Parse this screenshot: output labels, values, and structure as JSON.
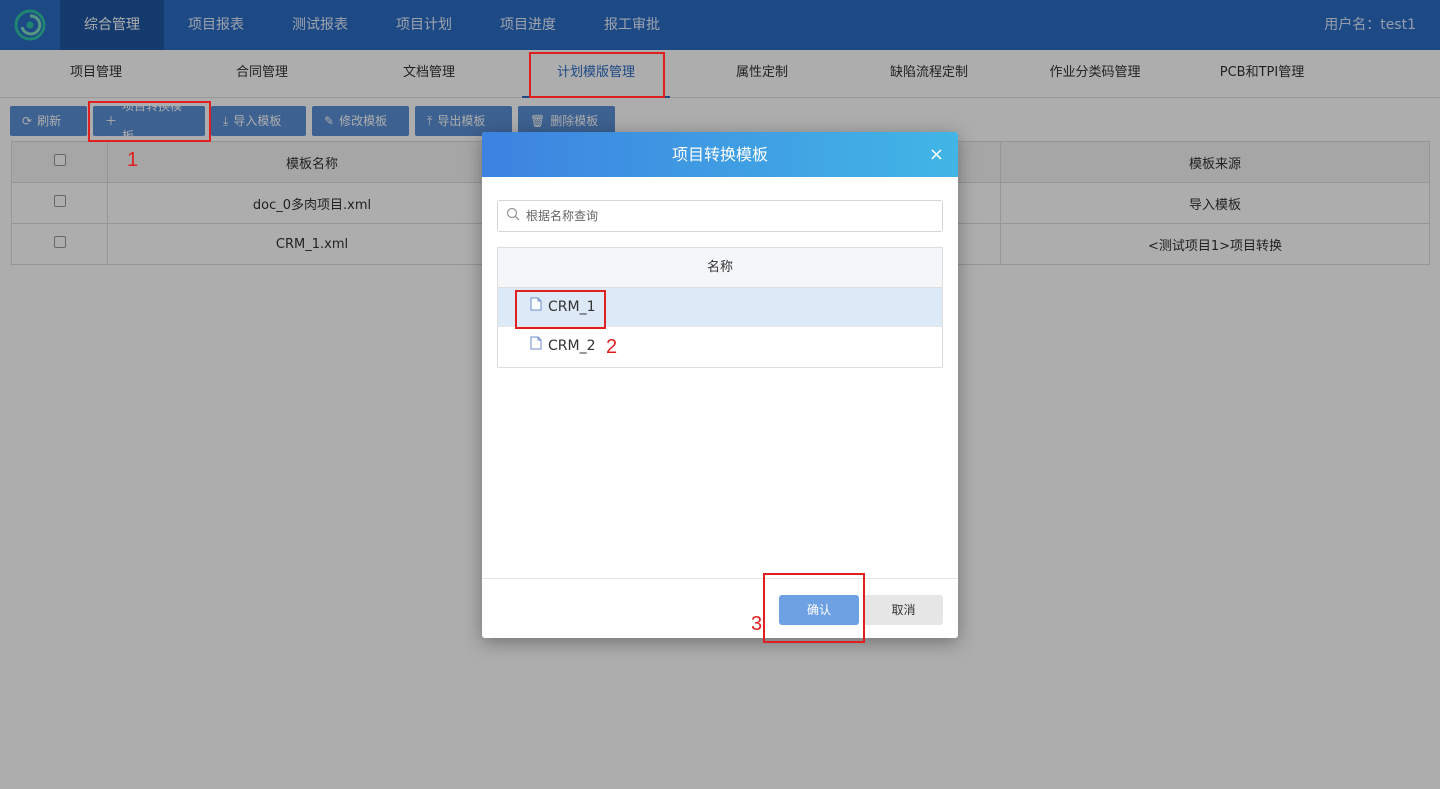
{
  "topnav": {
    "items": [
      "综合管理",
      "项目报表",
      "测试报表",
      "项目计划",
      "项目进度",
      "报工审批"
    ],
    "username": "用户名：test1"
  },
  "subnav": {
    "items": [
      "项目管理",
      "合同管理",
      "文档管理",
      "计划模版管理",
      "属性定制",
      "缺陷流程定制",
      "作业分类码管理",
      "PCB和TPI管理"
    ]
  },
  "toolbar": {
    "refresh": "刷新",
    "convert": "项目转换模板",
    "import": "导入模板",
    "edit": "修改模板",
    "export": "导出模板",
    "delete": "删除模板"
  },
  "table": {
    "col_name": "模板名称",
    "col_source": "模板来源",
    "rows": [
      {
        "name": "doc_0多肉项目.xml",
        "source": "导入模板"
      },
      {
        "name": "CRM_1.xml",
        "source": "<测试项目1>项目转换"
      }
    ]
  },
  "modal": {
    "title": "项目转换模板",
    "close": "×",
    "search_placeholder": "根据名称查询",
    "list_header": "名称",
    "items": [
      "CRM_1",
      "CRM_2"
    ],
    "ok": "确认",
    "cancel": "取消"
  },
  "annotations": [
    "1",
    "2",
    "3"
  ],
  "colors": {
    "nav_bg": "#2b6cc4",
    "accent": "#2b6cc4",
    "button_bg": "#5a8fd6",
    "mark_red": "#e02020"
  }
}
